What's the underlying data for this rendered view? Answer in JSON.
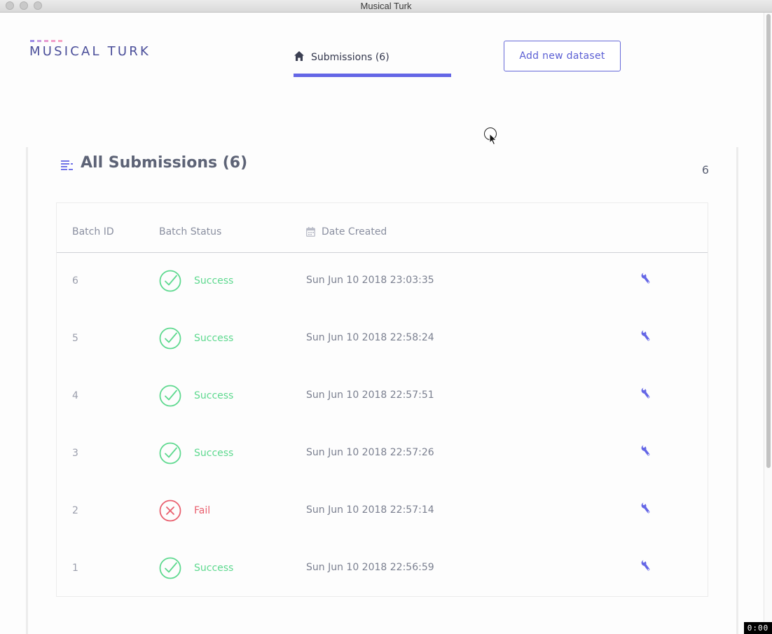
{
  "window": {
    "title": "Musical Turk"
  },
  "header": {
    "logo_text": "MUSICAL TURK",
    "logo_dot_colors": [
      "#9b8ae6",
      "#c79be0",
      "#e79ad0",
      "#f19dc8",
      "#f6a3c2"
    ],
    "nav_tab_label": "Submissions (6)",
    "nav_tab_icon": "home-icon",
    "add_dataset_label": "Add new dataset"
  },
  "colors": {
    "accent": "#6466e6",
    "success": "#5ed98f",
    "fail": "#e95f6e",
    "heading": "#5d6376"
  },
  "card": {
    "icon": "list-icon",
    "title": "All Submissions (6)",
    "count": "6"
  },
  "table": {
    "columns": [
      "Batch ID",
      "Batch Status",
      "Date Created"
    ],
    "date_column_icon": "calendar-icon",
    "rows": [
      {
        "id": "6",
        "status": "Success",
        "date": "Sun Jun 10 2018 23:03:35"
      },
      {
        "id": "5",
        "status": "Success",
        "date": "Sun Jun 10 2018 22:58:24"
      },
      {
        "id": "4",
        "status": "Success",
        "date": "Sun Jun 10 2018 22:57:51"
      },
      {
        "id": "3",
        "status": "Success",
        "date": "Sun Jun 10 2018 22:57:26"
      },
      {
        "id": "2",
        "status": "Fail",
        "date": "Sun Jun 10 2018 22:57:14"
      },
      {
        "id": "1",
        "status": "Success",
        "date": "Sun Jun 10 2018 22:56:59"
      }
    ],
    "row_action_icon": "wrench-icon"
  },
  "recorder": {
    "timer": "0:00"
  }
}
